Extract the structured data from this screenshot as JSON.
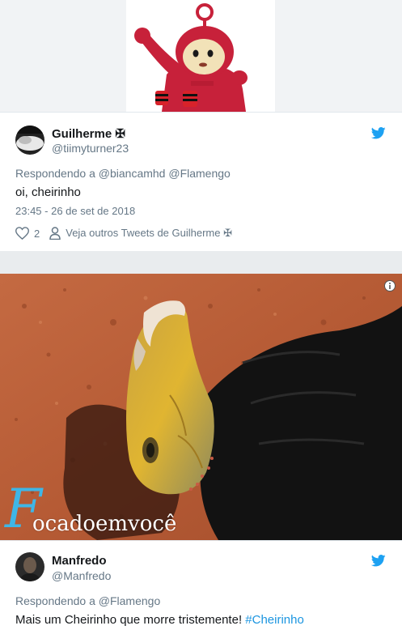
{
  "tweet1": {
    "name": "Guilherme ✠",
    "handle": "@tiimyturner23",
    "reply_prefix": "Respondendo a ",
    "reply_mentions": "@biancamhd @Flamengo",
    "text": "oi, cheirinho",
    "timestamp": "23:45 - 26 de set de 2018",
    "likes": "2",
    "more_tweets": "Veja outros Tweets de Guilherme ✠"
  },
  "photo": {
    "watermark_initial": "F",
    "watermark_text": "ocadoemvocê"
  },
  "tweet2": {
    "name": "Manfredo",
    "handle": "@Manfredo",
    "reply_prefix": "Respondendo a ",
    "reply_mentions": "@Flamengo",
    "text": "Mais um Cheirinho que morre tristemente! ",
    "hashtag": "#Cheirinho"
  },
  "colors": {
    "twitter_blue": "#1da1f2",
    "link_blue": "#1b95e0",
    "secondary_text": "#657786",
    "teletubby_red": "#c7213a"
  },
  "icons": [
    "twitter-bird-icon",
    "heart-icon",
    "person-icon",
    "info-icon"
  ]
}
